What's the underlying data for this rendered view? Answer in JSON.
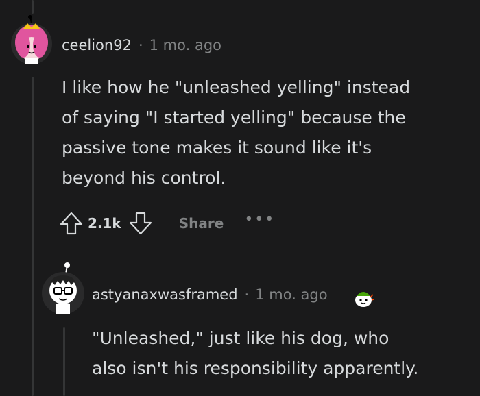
{
  "comments": [
    {
      "username": "ceelion92",
      "separator": "·",
      "time": "1 mo. ago",
      "body": "I like how he \"unleashed yelling\" instead\nof saying \"I started yelling\" because the\npassive tone makes it sound like it's\nbeyond his control.",
      "score": "2.1k",
      "share_label": "Share",
      "more_label": "•••"
    },
    {
      "username": "astyanaxwasframed",
      "separator": "·",
      "time": "1 mo. ago",
      "body": "\"Unleashed,\" just like his dog, who\nalso isn't his responsibility apparently."
    }
  ],
  "colors": {
    "background": "#1a1a1b",
    "text": "#d7dadc",
    "muted": "#818384",
    "thread_line": "#343536",
    "avatar_pink": "#e0559e"
  },
  "icons": [
    "user-avatar-pink",
    "upvote-icon",
    "downvote-icon",
    "more-options-icon",
    "user-avatar-glasses",
    "award-icon"
  ]
}
